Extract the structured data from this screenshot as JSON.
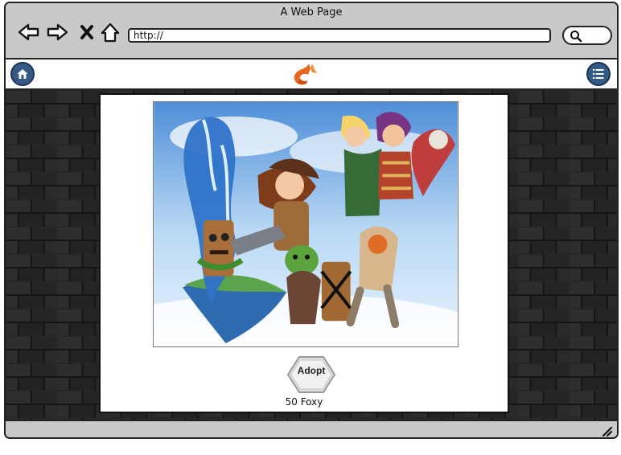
{
  "browser": {
    "title": "A Web Page",
    "address": "http://",
    "icons": [
      "back-arrow-icon",
      "forward-arrow-icon",
      "close-icon",
      "home-outline-icon",
      "search-icon"
    ]
  },
  "header": {
    "left_icon": "home-icon",
    "logo_icon": "fox-logo-icon",
    "right_icon": "menu-list-icon",
    "accent": "#355a86",
    "logo_color": "#e8661f"
  },
  "main": {
    "artwork_icon": "character-group-artwork",
    "adopt_label": "Adopt",
    "price": "50 Foxy"
  },
  "status": {
    "resize_icon": "resize-grip-icon"
  }
}
